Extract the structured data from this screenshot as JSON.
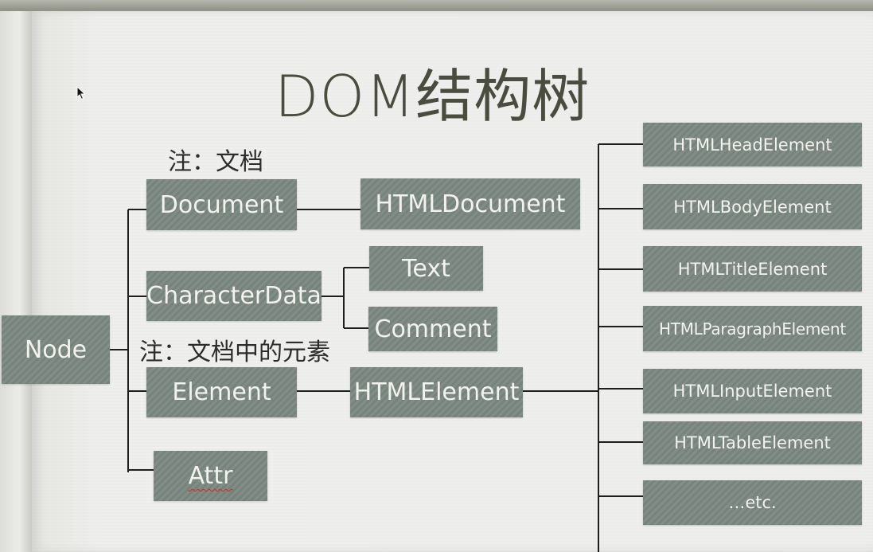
{
  "title": "DOM结构树",
  "notes": {
    "document_note": "注：文档",
    "element_note": "注：文档中的元素"
  },
  "nodes": {
    "node": "Node",
    "document": "Document",
    "html_document": "HTMLDocument",
    "character_data": "CharacterData",
    "text": "Text",
    "comment": "Comment",
    "element": "Element",
    "html_element": "HTMLElement",
    "attr": "Attr"
  },
  "html_elements": [
    "HTMLHeadElement",
    "HTMLBodyElement",
    "HTMLTitleElement",
    "HTMLParagraphElement",
    "HTMLInputElement",
    "HTMLTableElement",
    "…etc."
  ],
  "colors": {
    "box_fill": "#7b8781",
    "box_text": "#f2f3ef",
    "line": "#1e1e1e",
    "title": "#4a4c40"
  }
}
